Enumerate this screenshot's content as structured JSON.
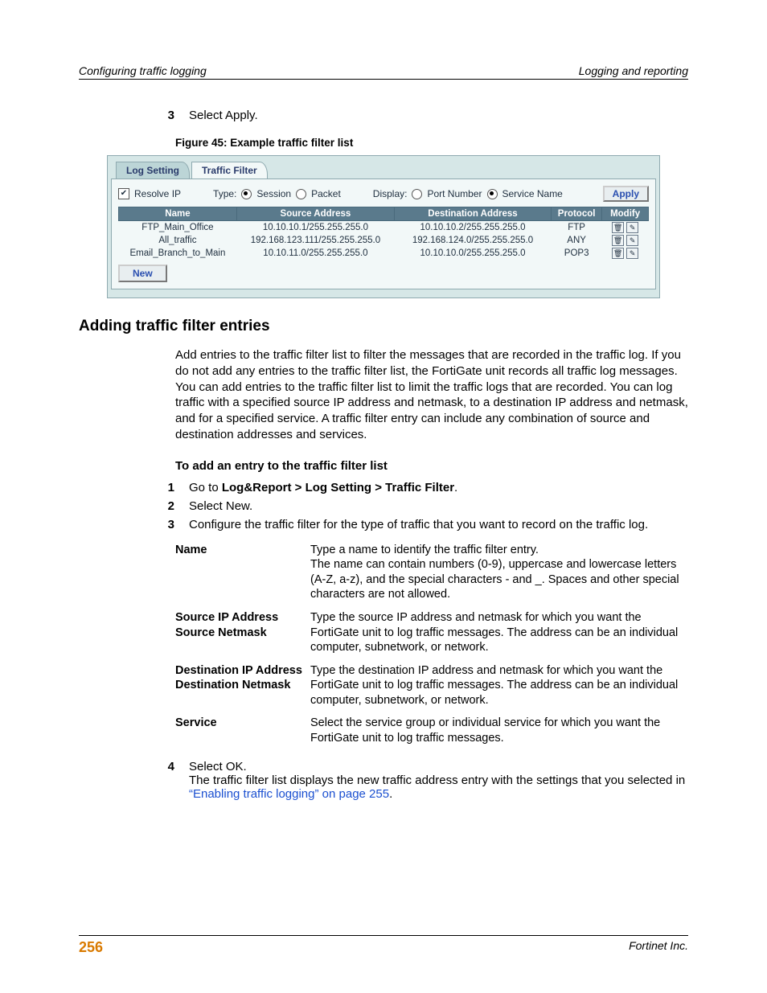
{
  "header": {
    "left": "Configuring traffic logging",
    "right": "Logging and reporting"
  },
  "step3": {
    "num": "3",
    "text": "Select Apply."
  },
  "figure": {
    "caption": "Figure 45: Example traffic filter list"
  },
  "ss": {
    "tabs": {
      "inactive": "Log Setting",
      "active": "Traffic Filter"
    },
    "resolve": "Resolve IP",
    "type_label": "Type:",
    "type_session": "Session",
    "type_packet": "Packet",
    "display_label": "Display:",
    "display_port": "Port Number",
    "display_service": "Service Name",
    "apply": "Apply",
    "cols": {
      "name": "Name",
      "src": "Source Address",
      "dst": "Destination Address",
      "proto": "Protocol",
      "mod": "Modify"
    },
    "rows": [
      {
        "name": "FTP_Main_Office",
        "src": "10.10.10.1/255.255.255.0",
        "dst": "10.10.10.2/255.255.255.0",
        "proto": "FTP"
      },
      {
        "name": "All_traffic",
        "src": "192.168.123.111/255.255.255.0",
        "dst": "192.168.124.0/255.255.255.0",
        "proto": "ANY"
      },
      {
        "name": "Email_Branch_to_Main",
        "src": "10.10.11.0/255.255.255.0",
        "dst": "10.10.10.0/255.255.255.0",
        "proto": "POP3"
      }
    ],
    "new": "New"
  },
  "section_title": "Adding traffic filter entries",
  "intro": "Add entries to the traffic filter list to filter the messages that are recorded in the traffic log. If you do not add any entries to the traffic filter list, the FortiGate unit records all traffic log messages. You can add entries to the traffic filter list to limit the traffic logs that are recorded. You can log traffic with a specified source IP address and netmask, to a destination IP address and netmask, and for a specified service. A traffic filter entry can include any combination of source and destination addresses and services.",
  "proc_title": "To add an entry to the traffic filter list",
  "p1": {
    "num": "1",
    "pre": "Go to ",
    "bold": "Log&Report > Log Setting > Traffic Filter",
    "post": "."
  },
  "p2": {
    "num": "2",
    "text": "Select New."
  },
  "p3": {
    "num": "3",
    "text": "Configure the traffic filter for the type of traffic that you want to record on the traffic log."
  },
  "defs": {
    "name_term": "Name",
    "name_desc1": "Type a name to identify the traffic filter entry.",
    "name_desc2": "The name can contain numbers (0-9), uppercase and lowercase letters (A-Z, a-z), and the special characters - and _. Spaces and other special characters are not allowed.",
    "src_term1": "Source IP Address",
    "src_term2": "Source Netmask",
    "src_desc": "Type the source IP address and netmask for which you want the FortiGate unit to log traffic messages. The address can be an individual computer, subnetwork, or network.",
    "dst_term1": "Destination IP Address",
    "dst_term2": "Destination Netmask",
    "dst_desc": "Type the destination IP address and netmask for which you want the FortiGate unit to log traffic messages. The address can be an individual computer, subnetwork, or network.",
    "svc_term": "Service",
    "svc_desc": "Select the service group or individual service for which you want the FortiGate unit to log traffic messages."
  },
  "p4": {
    "num": "4",
    "line1": "Select OK.",
    "line2_pre": "The traffic filter list displays the new traffic address entry with the settings that you selected in ",
    "link": "“Enabling traffic logging” on page 255",
    "line2_post": "."
  },
  "footer": {
    "page": "256",
    "right": "Fortinet Inc."
  }
}
